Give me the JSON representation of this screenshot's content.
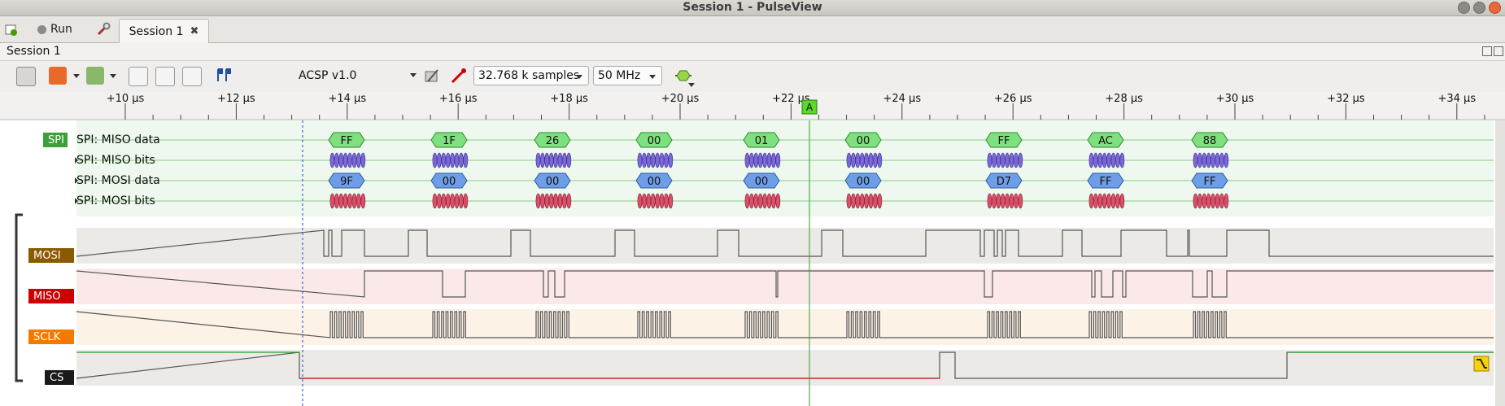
{
  "window": {
    "title": "Session 1 - PulseView"
  },
  "tabbar": {
    "run_label": "Run",
    "tab_label": "Session 1",
    "tab_close": "✖"
  },
  "session": {
    "label": "Session 1"
  },
  "toolbar": {
    "decoder": "ACSP v1.0",
    "samples": "32.768 k samples",
    "samplerate": "50 MHz"
  },
  "ruler": {
    "ticks": [
      "+10 µs",
      "+12 µs",
      "+14 µs",
      "+16 µs",
      "+18 µs",
      "+20 µs",
      "+22 µs",
      "+24 µs",
      "+26 µs",
      "+28 µs",
      "+30 µs",
      "+32 µs",
      "+34 µs"
    ],
    "cursor_marker": "A"
  },
  "decoder_rows": {
    "badge": "SPI",
    "labels": [
      "SPI: MISO data",
      "SPI: MISO bits",
      "SPI: MOSI data",
      "SPI: MOSI bits"
    ],
    "miso_data": [
      "FF",
      "1F",
      "26",
      "00",
      "01",
      "00",
      "FF",
      "AC",
      "88"
    ],
    "mosi_data": [
      "9F",
      "00",
      "00",
      "00",
      "00",
      "00",
      "D7",
      "FF",
      "FF"
    ]
  },
  "channels": [
    {
      "name": "MOSI",
      "color": "#8b5a00"
    },
    {
      "name": "MISO",
      "color": "#cc0000"
    },
    {
      "name": "SCLK",
      "color": "#f57900"
    },
    {
      "name": "CS",
      "color": "#1a1a1a"
    }
  ],
  "colors": {
    "miso_data": "#7ee07e",
    "miso_bits": "#7b68d8",
    "mosi_data": "#6f9ee8",
    "mosi_bits": "#d8506a",
    "trace_high": "#2aa02a",
    "trace_low": "#c02020"
  }
}
